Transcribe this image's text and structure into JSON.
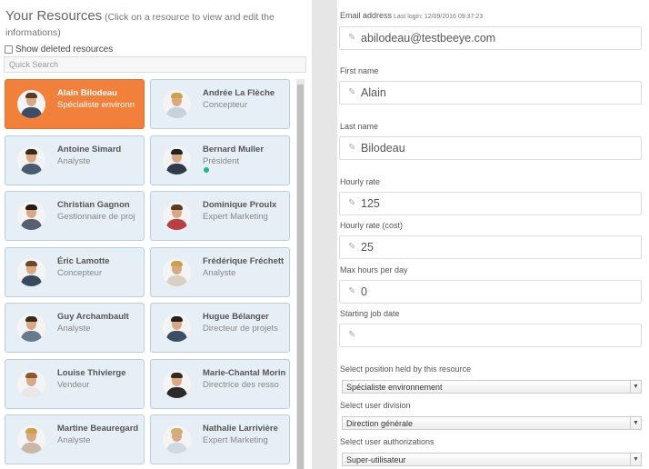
{
  "resources": {
    "title": "Your Resources",
    "instruction": "(Click on a resource to view and edit the informations)",
    "show_deleted_label": "Show deleted resources",
    "quick_search_placeholder": "Quick Search",
    "cards": [
      {
        "name": "Alain Bilodeau",
        "role": "Spécialiste environn",
        "active": true
      },
      {
        "name": "Andrée La Flèche",
        "role": "Concepteur"
      },
      {
        "name": "Antoine Simard",
        "role": "Analyste"
      },
      {
        "name": "Bernard Muller",
        "role": "Président",
        "online": true
      },
      {
        "name": "Christian Gagnon",
        "role": "Gestionnaire de proj"
      },
      {
        "name": "Dominique Proulx",
        "role": "Expert Marketing"
      },
      {
        "name": "Éric Lamotte",
        "role": "Concepteur"
      },
      {
        "name": "Frédérique Fréchett",
        "role": "Analyste"
      },
      {
        "name": "Guy Archambault",
        "role": "Analyste"
      },
      {
        "name": "Hugue Bélanger",
        "role": "Directeur de projets"
      },
      {
        "name": "Louise Thivierge",
        "role": "Vendeur"
      },
      {
        "name": "Marie-Chantal Morin",
        "role": "Directrice des resso"
      },
      {
        "name": "Martine Beauregard",
        "role": "Analyste"
      },
      {
        "name": "Nathalie Larrivière",
        "role": "Expert Marketing"
      }
    ]
  },
  "form": {
    "email_label": "Email address",
    "last_login": "Last login: 12/09/2016 09:37:23",
    "email_value": "abilodeau@testbeeye.com",
    "first_name_label": "First name",
    "first_name_value": "Alain",
    "last_name_label": "Last name",
    "last_name_value": "Bilodeau",
    "hourly_rate_label": "Hourly rate",
    "hourly_rate_value": "125",
    "hourly_cost_label": "Hourly rate (cost)",
    "hourly_cost_value": "25",
    "max_hours_label": "Max hours per day",
    "max_hours_value": "0",
    "start_date_label": "Starting job date",
    "start_date_value": "",
    "position_label": "Select position held by this resource",
    "position_value": "Spécialiste environnement",
    "division_label": "Select user division",
    "division_value": "Direction générale",
    "authorizations_label": "Select user authorizations",
    "authorizations_value": "Super-utilisateur"
  },
  "colors": {
    "active_card": "#f0803a",
    "card_bg": "#e6eef6",
    "online_dot": "#1fb58f"
  }
}
